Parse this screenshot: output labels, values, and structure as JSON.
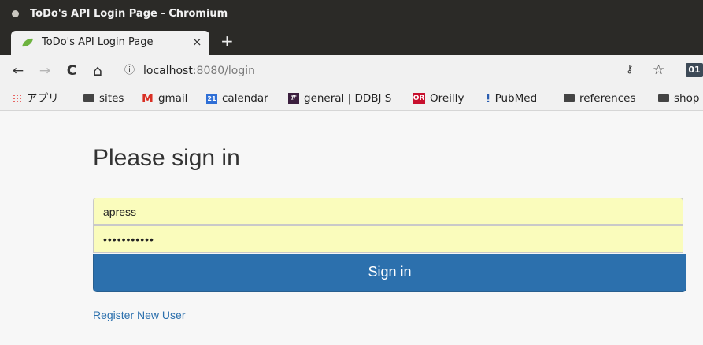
{
  "window": {
    "title": "ToDo's API Login Page - Chromium"
  },
  "tab": {
    "title": "ToDo's API Login Page",
    "close_glyph": "×",
    "new_tab_glyph": "+",
    "favicon": "spring-leaf-icon"
  },
  "toolbar": {
    "back_glyph": "←",
    "forward_glyph": "→",
    "reload_glyph": "C",
    "home_glyph": "⌂",
    "info_glyph": "ⓘ",
    "url_host": "localhost",
    "url_path": ":8080/login",
    "key_glyph": "⚷",
    "star_glyph": "☆",
    "extension_label": "01"
  },
  "bookmarks": [
    {
      "label": "アプリ",
      "icon": "apps-grid-icon"
    },
    {
      "label": "sites",
      "icon": "folder-icon"
    },
    {
      "label": "gmail",
      "icon": "gmail-icon"
    },
    {
      "label": "calendar",
      "icon": "calendar-icon"
    },
    {
      "label": "general | DDBJ S",
      "icon": "slack-icon"
    },
    {
      "label": "Oreilly",
      "icon": "oreilly-icon"
    },
    {
      "label": "PubMed",
      "icon": "pubmed-icon"
    },
    {
      "label": "references",
      "icon": "folder-icon"
    },
    {
      "label": "shop",
      "icon": "folder-icon"
    }
  ],
  "bookmark_icons": {
    "gmail": "M",
    "calendar": "21",
    "slack": "#",
    "oreilly": "OR",
    "pubmed": "ⵑ"
  },
  "login": {
    "heading": "Please sign in",
    "username_value": "apress",
    "password_value": "•••••••••••",
    "submit_label": "Sign in",
    "register_link": "Register New User"
  },
  "colors": {
    "button_bg": "#2c70ad",
    "field_autofill_bg": "#fafcbc",
    "link": "#2c70ad"
  }
}
